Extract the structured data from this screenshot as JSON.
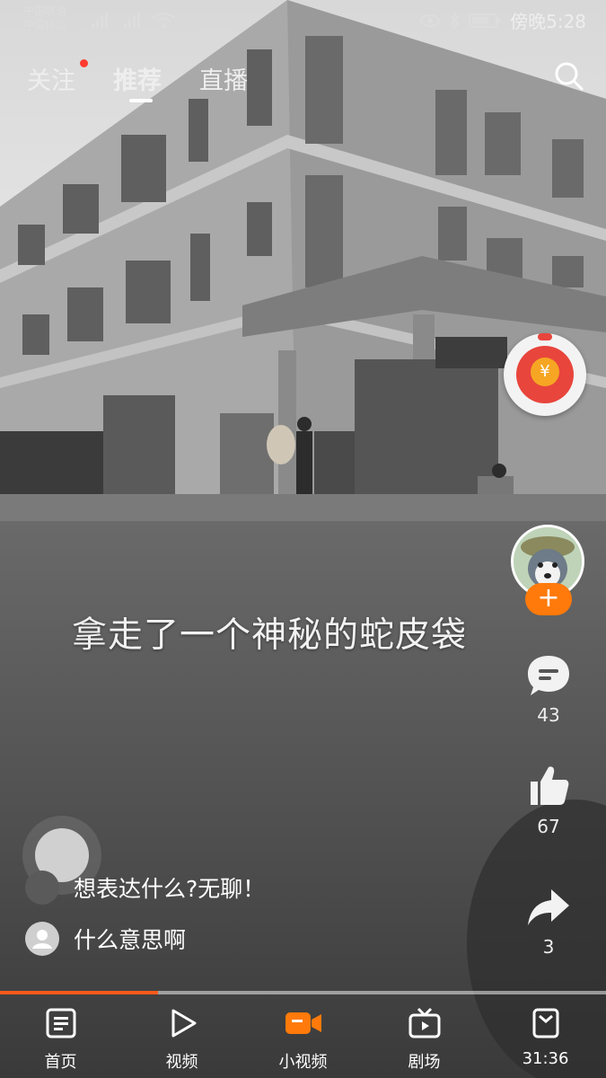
{
  "status_bar": {
    "carrier_1": "中国联通",
    "carrier_2": "中国移动",
    "time": "傍晚5:28"
  },
  "top_nav": {
    "tabs": [
      "关注",
      "推荐",
      "直播"
    ],
    "active_tab": "推荐"
  },
  "video": {
    "caption": "拿走了一个神秘的蛇皮袋"
  },
  "side_actions": {
    "comment_count": "43",
    "like_count": "67",
    "share_count": "3",
    "follow_label": "+"
  },
  "comments": [
    {
      "text": "想表达什么?无聊！"
    },
    {
      "text": "什么意思啊"
    }
  ],
  "progress": {
    "played_fraction": 0.26
  },
  "bottom_nav": {
    "items": [
      {
        "label": "首页",
        "icon": "home-icon"
      },
      {
        "label": "视频",
        "icon": "play-icon"
      },
      {
        "label": "小视频",
        "icon": "camera-icon"
      },
      {
        "label": "剧场",
        "icon": "tv-icon"
      },
      {
        "label": "31:36",
        "icon": "task-icon"
      }
    ],
    "active_index": 2
  },
  "colors": {
    "accent": "#ff7a0a",
    "red_dot": "#ff3b30",
    "progress": "#ff5a1a"
  }
}
